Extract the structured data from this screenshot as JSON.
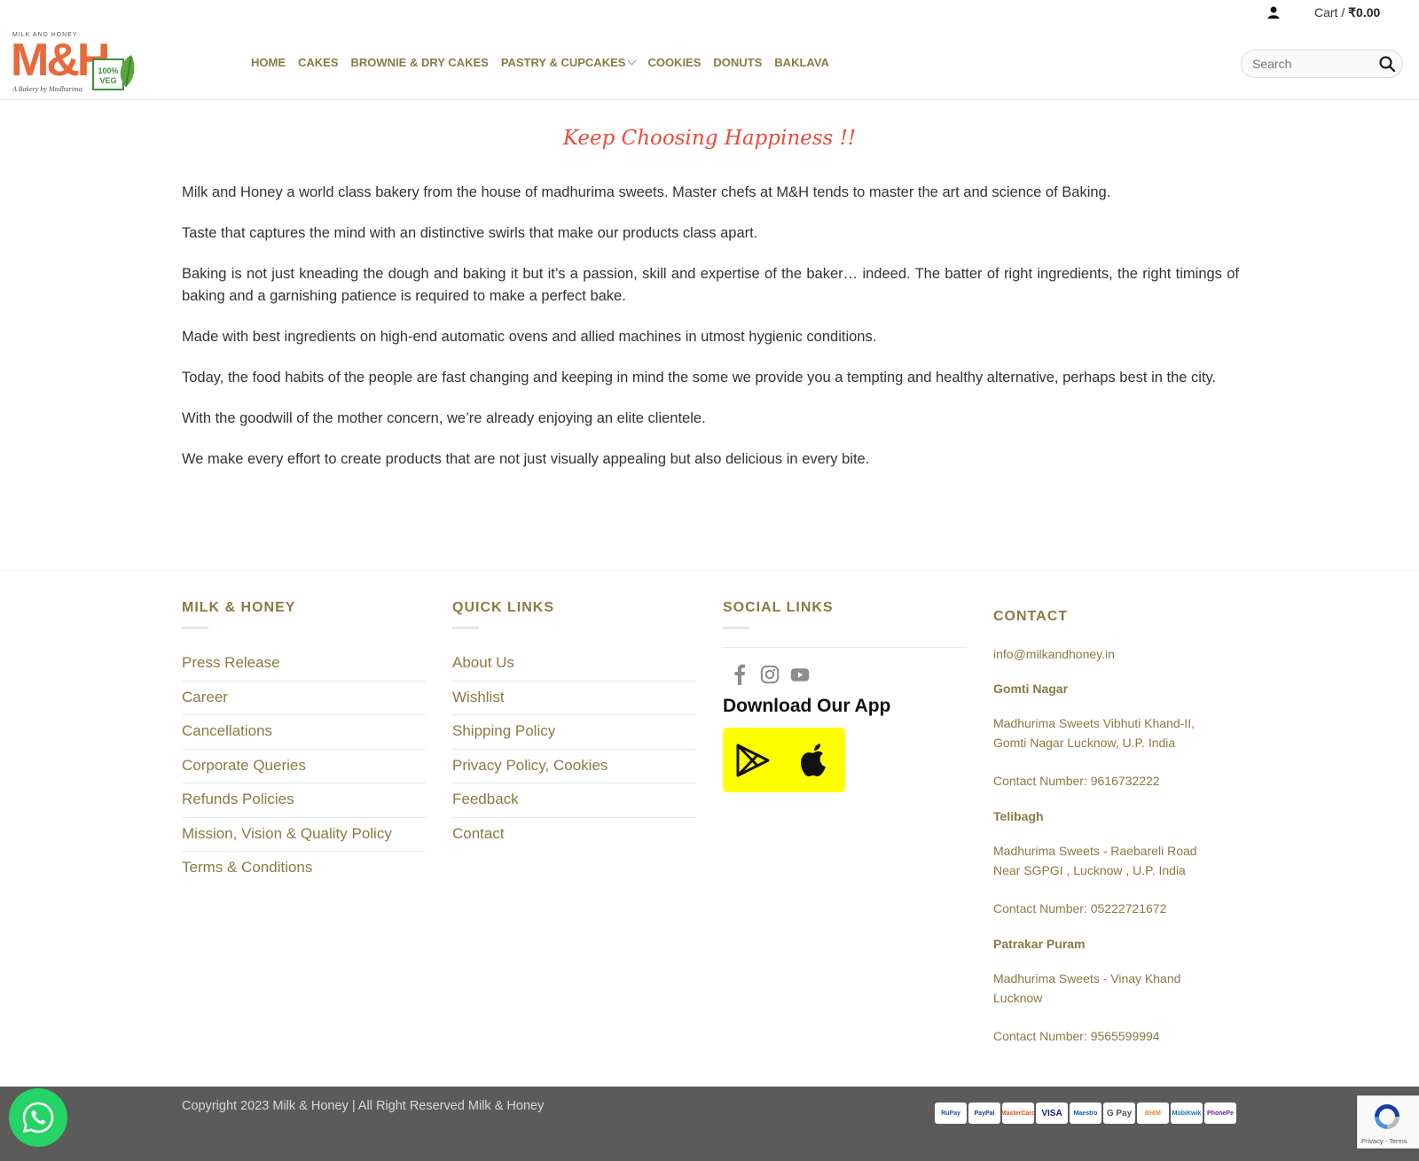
{
  "header": {
    "cart_label": "Cart /",
    "cart_amount": "₹0.00",
    "logo": {
      "top_text": "MILK AND HONEY",
      "mark": "M&H",
      "tagline": "A Bakery by Madhurima",
      "veg_badge": "100% VEG"
    },
    "nav": [
      {
        "label": "HOME"
      },
      {
        "label": "CAKES"
      },
      {
        "label": "BROWNIE & DRY CAKES"
      },
      {
        "label": "PASTRY & CUPCAKES"
      },
      {
        "label": "COOKIES"
      },
      {
        "label": "DONUTS"
      },
      {
        "label": "BAKLAVA"
      }
    ],
    "search": {
      "placeholder": "Search",
      "icon": "search-icon"
    }
  },
  "main": {
    "headline": "Keep Choosing Happiness !!",
    "paragraphs": [
      "Milk and Honey a world class bakery from the house of madhurima sweets. Master chefs at M&H tends to master the art and science of Baking.",
      "Taste that captures the mind with an distinctive swirls that make our products class apart.",
      "Baking is not just kneading the dough and baking it but it’s a passion, skill and expertise of the baker… indeed. The batter of right ingredients, the right timings of baking and a garnishing patience is required to make a perfect bake.",
      "Made with best ingredients on high-end automatic ovens and allied machines in utmost hygienic conditions.",
      "Today, the food habits of the people are fast changing and keeping in mind the some we provide you a tempting and healthy alternative, perhaps best in the city.",
      "With the goodwill of the mother concern, we’re already enjoying an elite clientele.",
      "We make every effort to create products that are not just visually appealing but also delicious in every bite."
    ]
  },
  "footer": {
    "milk_honey": {
      "title": "MILK & HONEY",
      "links": [
        "Press Release",
        "Career",
        "Cancellations",
        "Corporate Queries",
        "Refunds Policies",
        "Mission, Vision & Quality Policy",
        "Terms & Conditions"
      ]
    },
    "quick_links": {
      "title": "QUICK LINKS",
      "links": [
        "About Us",
        "Wishlist",
        "Shipping Policy",
        "Privacy Policy, Cookies",
        "Feedback",
        "Contact"
      ]
    },
    "social": {
      "title": "SOCIAL LINKS",
      "icons": [
        "facebook-icon",
        "instagram-icon",
        "youtube-icon"
      ],
      "app_title": "Download Our App",
      "app_color": "#ffff00"
    },
    "contact": {
      "title": "CONTACT",
      "email": "info@milkandhoney.in",
      "branches": [
        {
          "name": "Gomti Nagar",
          "address_1": "Madhurima Sweets Vibhuti Khand-II,",
          "address_2": "Gomti Nagar Lucknow, U.P. India",
          "phone": "Contact Number: 9616732222"
        },
        {
          "name": "Telibagh",
          "address_1": "Madhurima Sweets - Raebareli Road",
          "address_2": "Near SGPGI , Lucknow , U.P. India",
          "phone": "Contact Number: 05222721672"
        },
        {
          "name": "Patrakar Puram",
          "address_1": "Madhurima Sweets - Vinay Khand",
          "address_2": "Lucknow",
          "phone": "Contact Number: 9565599994"
        }
      ]
    }
  },
  "bottom": {
    "copyright": "Copyright 2023 Milk & Honey | All Right Reserved Milk & Honey",
    "payments": [
      "RuPay",
      "PayPal",
      "MasterCard",
      "VISA",
      "Maestro",
      "G Pay",
      "BHIM",
      "MobiKwik",
      "PhonePe"
    ]
  },
  "recaptcha": {
    "text": "Privacy - Terms"
  },
  "colors": {
    "accent": "#8a7a44",
    "headline": "#e74c3c",
    "whatsapp": "#25d366",
    "bottom_bar": "#5b5b5b"
  }
}
